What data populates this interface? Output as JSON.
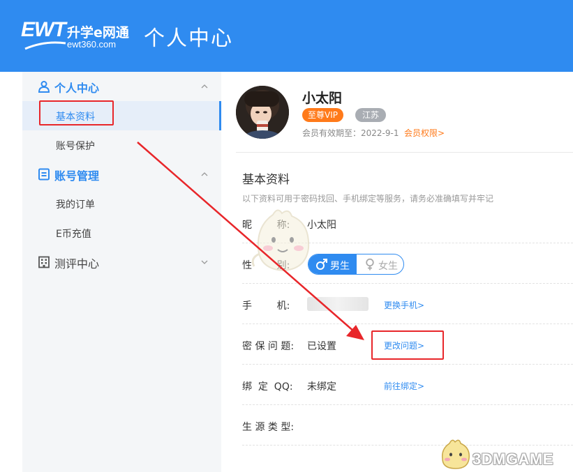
{
  "header": {
    "logo_brand": "EWT",
    "logo_cn": "升学e网通",
    "logo_url": "ewt360.com",
    "title": "个人中心"
  },
  "sidebar": {
    "groups": [
      {
        "label": "个人中心",
        "icon": "user-icon",
        "expanded": true,
        "items": [
          {
            "label": "基本资料",
            "active": true
          },
          {
            "label": "账号保护",
            "active": false
          }
        ]
      },
      {
        "label": "账号管理",
        "icon": "account-icon",
        "expanded": true,
        "items": [
          {
            "label": "我的订单",
            "active": false
          },
          {
            "label": "E币充值",
            "active": false
          }
        ]
      },
      {
        "label": "测评中心",
        "icon": "building-icon",
        "expanded": false,
        "items": []
      }
    ]
  },
  "profile": {
    "name": "小太阳",
    "vip_badge": "至尊VIP",
    "province_badge": "江苏",
    "expire_text": "会员有效期至：2022-9-1",
    "rights_link": "会员权限>"
  },
  "basic_info": {
    "title": "基本资料",
    "description": "以下资料可用于密码找回、手机绑定等服务，请务必准确填写并牢记",
    "nickname_label": "昵        称:",
    "nickname_value": "小太阳",
    "gender_label": "性        别:",
    "gender_male": "男生",
    "gender_female": "女生",
    "gender_selected": "男生",
    "phone_label": "手        机:",
    "phone_link": "更换手机>",
    "security_label": "密 保 问 题:",
    "security_value": "已设置",
    "security_link": "更改问题>",
    "qq_label": "绑  定  QQ:",
    "qq_value": "未绑定",
    "qq_link": "前往绑定>",
    "source_label": "生 源 类 型:"
  },
  "watermark": "3DMGAME",
  "colors": {
    "primary": "#2f8bf0",
    "vip": "#ff7a1a",
    "annotation": "#e8262a"
  }
}
